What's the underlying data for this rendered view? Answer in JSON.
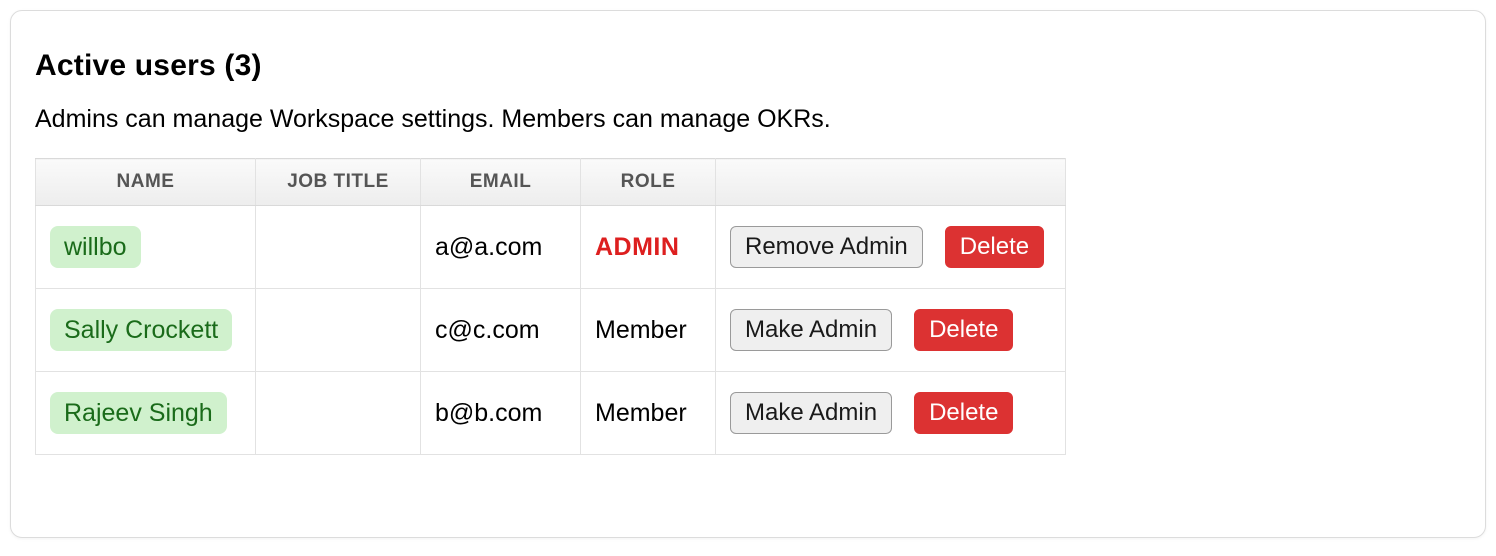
{
  "title_prefix": "Active users",
  "user_count": "3",
  "subtitle": "Admins can manage Workspace settings. Members can manage OKRs.",
  "columns": {
    "name": "NAME",
    "job_title": "JOB TITLE",
    "email": "EMAIL",
    "role": "ROLE",
    "actions": ""
  },
  "labels": {
    "remove_admin": "Remove Admin",
    "make_admin": "Make Admin",
    "delete": "Delete"
  },
  "rows": [
    {
      "name": "willbo",
      "job_title": "",
      "email": "a@a.com",
      "role": "ADMIN",
      "is_admin": true
    },
    {
      "name": "Sally Crockett",
      "job_title": "",
      "email": "c@c.com",
      "role": "Member",
      "is_admin": false
    },
    {
      "name": "Rajeev Singh",
      "job_title": "",
      "email": "b@b.com",
      "role": "Member",
      "is_admin": false
    }
  ]
}
